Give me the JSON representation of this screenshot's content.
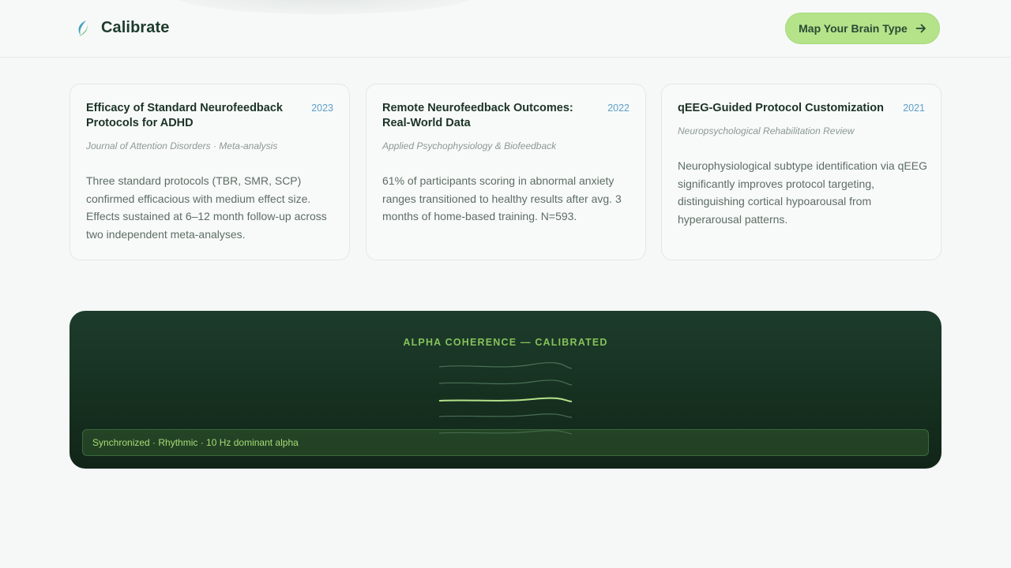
{
  "header": {
    "brand": "Calibrate",
    "cta_label": "Map Your Brain Type",
    "logo_icon": "leaf-wave-icon",
    "cta_icon": "arrow-right-icon"
  },
  "cards": [
    {
      "title": "Efficacy of Standard Neurofeedback Protocols for ADHD",
      "year": "2023",
      "journal": "Journal of Attention Disorders · Meta-analysis",
      "description": "Three standard protocols (TBR, SMR, SCP) confirmed efficacious with medium effect size. Effects sustained at 6–12 month follow-up across two independent meta-analyses."
    },
    {
      "title": "Remote Neurofeedback Outcomes: Real-World Data",
      "year": "2022",
      "journal": "Applied Psychophysiology & Biofeedback",
      "description": "61% of participants scoring in abnormal anxiety ranges transitioned to healthy results after avg. 3 months of home-based training. N=593."
    },
    {
      "title": "qEEG-Guided Protocol Customization",
      "year": "2021",
      "journal": "Neuropsychological Rehabilitation Review",
      "description": "Neurophysiological subtype identification via qEEG significantly improves protocol targeting, distinguishing cortical hypoarousal from hyperarousal patterns."
    }
  ],
  "alpha_panel": {
    "title": "ALPHA COHERENCE — CALIBRATED",
    "status": "Synchronized · Rhythmic · 10 Hz dominant alpha"
  },
  "colors": {
    "accent_green": "#b5e38a",
    "panel_dark": "#163020",
    "year_blue": "#5d9fc9",
    "alpha_label": "#86c25a"
  }
}
